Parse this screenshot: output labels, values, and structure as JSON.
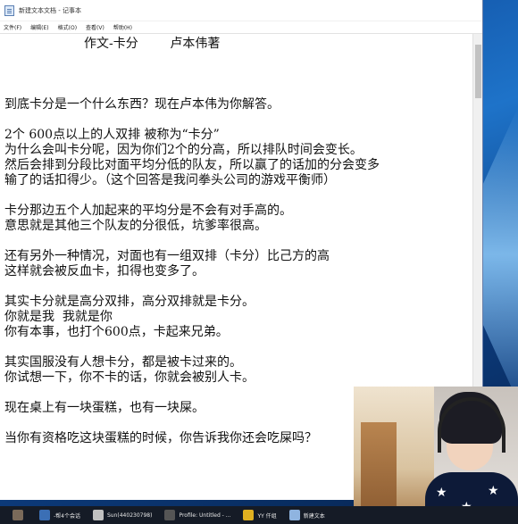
{
  "window": {
    "title": "新建文本文档 - 记事本"
  },
  "menu": {
    "items": [
      "文件(F)",
      "编辑(E)",
      "格式(O)",
      "查看(V)",
      "帮助(H)"
    ]
  },
  "document": {
    "lines": [
      "                    作文-卡分        卢本伟著",
      "",
      "",
      "",
      "到底卡分是一个什么东西？现在卢本伟为你解答。",
      "",
      "2个 600点以上的人双排 被称为“卡分”",
      "为什么会叫卡分呢，因为你们2个的分高，所以排队时间会变长。",
      "然后会排到分段比对面平均分低的队友，所以赢了的话加的分会变多",
      "输了的话扣得少。（这个回答是我问拳头公司的游戏平衡师）",
      "",
      "卡分那边五个人加起来的平均分是不会有对手高的。",
      "意思就是其他三个队友的分很低，坑爹率很高。",
      "",
      "还有另外一种情况，对面也有一组双排（卡分）比己方的高",
      "这样就会被反血卡，扣得也变多了。",
      "",
      "其实卡分就是高分双排，高分双排就是卡分。",
      "你就是我  我就是你",
      "你有本事，也打个600点，卡起来兄弟。",
      "",
      "其实国服没有人想卡分，都是被卡过来的。",
      "你试想一下，你不卡的话，你就会被别人卡。",
      "",
      "现在桌上有一块蛋糕，也有一块屎。",
      "",
      "当你有资格吃这块蛋糕的时候，你告诉我你还会吃屎吗？"
    ]
  },
  "taskbar": {
    "items": [
      {
        "label": "",
        "icon": "app-icon",
        "color": "#7a6a5a"
      },
      {
        "label": "-帮4个会话",
        "icon": "chat-icon",
        "color": "#3b6fb5"
      },
      {
        "label": "Sun(440230798)",
        "icon": "qq-icon",
        "color": "#c0c0c0"
      },
      {
        "label": "Profile: Untitled - ...",
        "icon": "profile-icon",
        "color": "#555555"
      },
      {
        "label": "YY 仟组",
        "icon": "yy-icon",
        "color": "#e0b020"
      },
      {
        "label": "新建文本",
        "icon": "notepad-icon",
        "color": "#8fb4e0"
      }
    ]
  },
  "colors": {
    "desktop": "#1b4f9c",
    "taskbar": "#151b26",
    "text": "#111111"
  }
}
